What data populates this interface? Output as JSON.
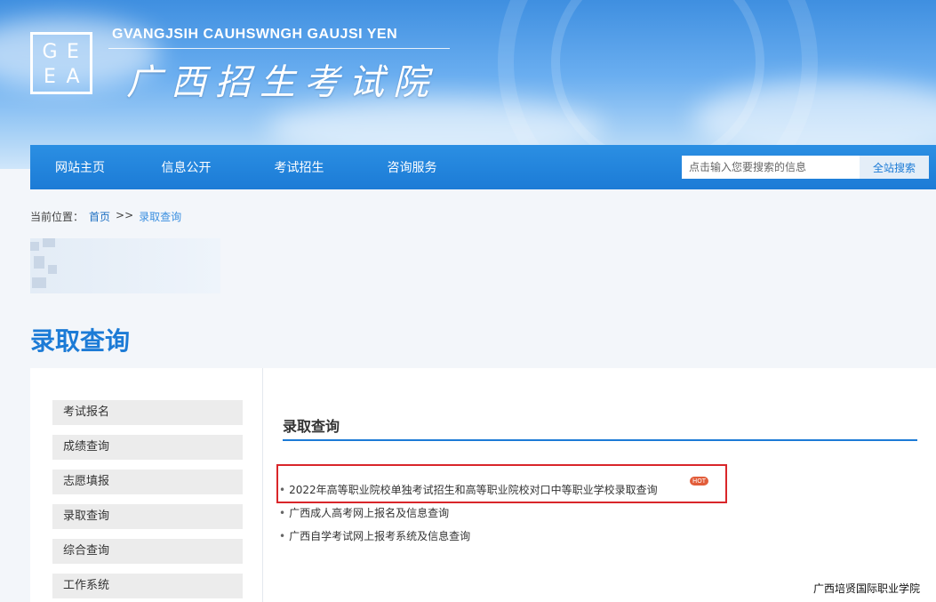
{
  "header": {
    "logo_letters": [
      "G",
      "E",
      "E",
      "A"
    ],
    "site_name_en": "GVANGJSIH CAUHSWNGH GAUJSI YEN",
    "site_name_cn": "广西招生考试院"
  },
  "nav": {
    "items": [
      "网站主页",
      "信息公开",
      "考试招生",
      "咨询服务"
    ],
    "search_placeholder": "点击输入您要搜索的信息",
    "search_button": "全站搜索"
  },
  "breadcrumb": {
    "label": "当前位置：",
    "home": "首页",
    "sep": ">>",
    "current": "录取查询"
  },
  "page_title": "录取查询",
  "sidebar": {
    "items": [
      "考试报名",
      "成绩查询",
      "志愿填报",
      "录取查询",
      "综合查询",
      "工作系统"
    ]
  },
  "main": {
    "title": "录取查询",
    "items": [
      "2022年高等职业院校单独考试招生和高等职业院校对口中等职业学校录取查询",
      "广西成人高考网上报名及信息查询",
      "广西自学考试网上报考系统及信息查询"
    ],
    "hot_badge": "HOT"
  },
  "watermark": "广西培贤国际职业学院",
  "colors": {
    "accent": "#1c7bd6",
    "highlight": "#d9262a"
  }
}
